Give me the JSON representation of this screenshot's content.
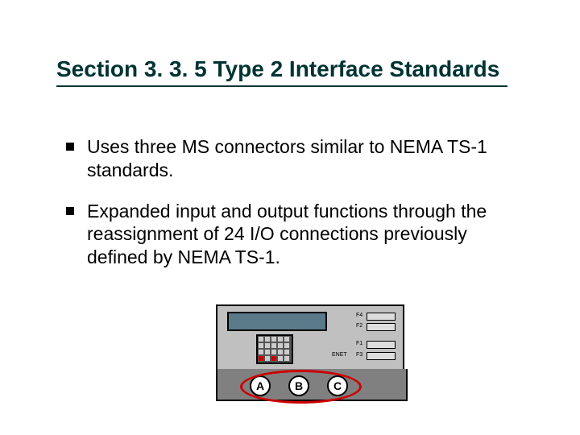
{
  "title": "Section 3. 3. 5 Type 2 Interface Standards",
  "bullets": [
    "Uses three MS connectors similar to NEMA TS-1 standards.",
    "Expanded input and output functions through the reassignment of 24 I/O connections previously defined by NEMA TS-1."
  ],
  "device": {
    "fn_labels": {
      "f1": "F1",
      "f2": "F2",
      "f3": "F3",
      "f4": "F4",
      "enter": "ENET"
    },
    "connectors": [
      "A",
      "B",
      "C"
    ]
  }
}
